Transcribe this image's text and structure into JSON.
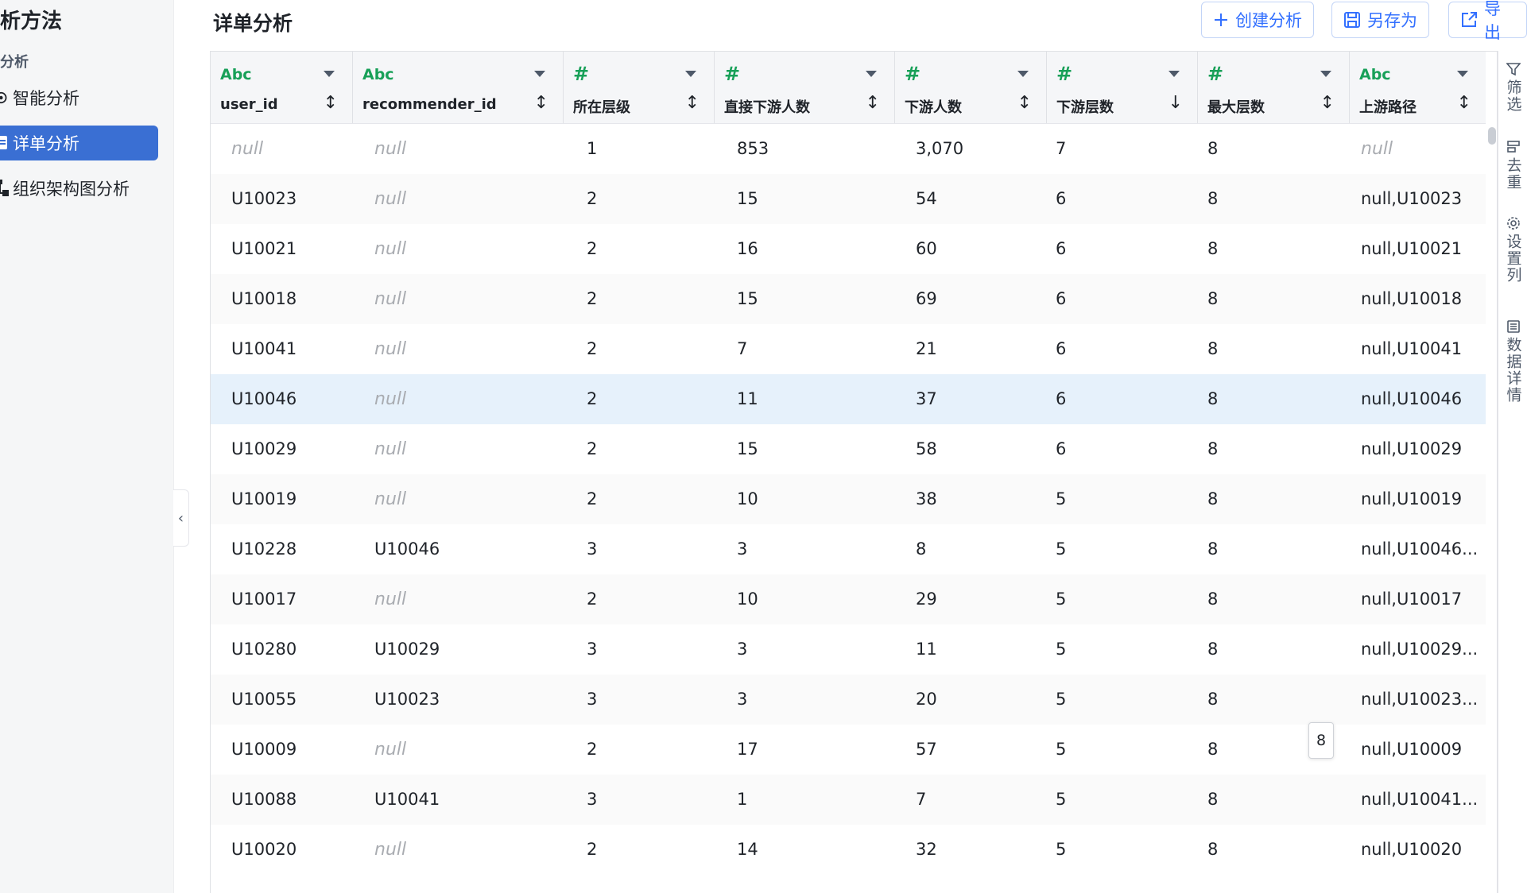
{
  "sidebar": {
    "title": "析方法",
    "section": "分析",
    "items": [
      {
        "label": "智能分析",
        "icon": "dashboard-icon",
        "active": false
      },
      {
        "label": "详单分析",
        "icon": "document-icon",
        "active": true
      },
      {
        "label": "组织架构图分析",
        "icon": "org-chart-icon",
        "active": false
      }
    ],
    "collapse_icon": "chevron-left-icon"
  },
  "header": {
    "title": "详单分析",
    "buttons": {
      "create": "创建分析",
      "save_as": "另存为",
      "export": "导出"
    }
  },
  "table": {
    "columns": [
      {
        "type": "Abc",
        "name": "user_id",
        "sort": "↕"
      },
      {
        "type": "Abc",
        "name": "recommender_id",
        "sort": "↕"
      },
      {
        "type": "#",
        "name": "所在层级",
        "sort": "↕"
      },
      {
        "type": "#",
        "name": "直接下游人数",
        "sort": "↕"
      },
      {
        "type": "#",
        "name": "下游人数",
        "sort": "↕"
      },
      {
        "type": "#",
        "name": "下游层数",
        "sort": "↓"
      },
      {
        "type": "#",
        "name": "最大层数",
        "sort": "↕"
      },
      {
        "type": "Abc",
        "name": "上游路径",
        "sort": "↕"
      }
    ],
    "rows": [
      [
        "null",
        "null",
        "1",
        "853",
        "3,070",
        "7",
        "8",
        "null"
      ],
      [
        "U10023",
        "null",
        "2",
        "15",
        "54",
        "6",
        "8",
        "null,U10023"
      ],
      [
        "U10021",
        "null",
        "2",
        "16",
        "60",
        "6",
        "8",
        "null,U10021"
      ],
      [
        "U10018",
        "null",
        "2",
        "15",
        "69",
        "6",
        "8",
        "null,U10018"
      ],
      [
        "U10041",
        "null",
        "2",
        "7",
        "21",
        "6",
        "8",
        "null,U10041"
      ],
      [
        "U10046",
        "null",
        "2",
        "11",
        "37",
        "6",
        "8",
        "null,U10046"
      ],
      [
        "U10029",
        "null",
        "2",
        "15",
        "58",
        "6",
        "8",
        "null,U10029"
      ],
      [
        "U10019",
        "null",
        "2",
        "10",
        "38",
        "5",
        "8",
        "null,U10019"
      ],
      [
        "U10228",
        "U10046",
        "3",
        "3",
        "8",
        "5",
        "8",
        "null,U10046..."
      ],
      [
        "U10017",
        "null",
        "2",
        "10",
        "29",
        "5",
        "8",
        "null,U10017"
      ],
      [
        "U10280",
        "U10029",
        "3",
        "3",
        "11",
        "5",
        "8",
        "null,U10029..."
      ],
      [
        "U10055",
        "U10023",
        "3",
        "3",
        "20",
        "5",
        "8",
        "null,U10023..."
      ],
      [
        "U10009",
        "null",
        "2",
        "17",
        "57",
        "5",
        "8",
        "null,U10009"
      ],
      [
        "U10088",
        "U10041",
        "3",
        "1",
        "7",
        "5",
        "8",
        "null,U10041..."
      ],
      [
        "U10020",
        "null",
        "2",
        "14",
        "32",
        "5",
        "8",
        "null,U10020"
      ]
    ],
    "highlighted_row": 5,
    "tooltip": "8"
  },
  "rail": {
    "items": [
      {
        "label": "筛选",
        "icon": "filter-icon"
      },
      {
        "label": "去重",
        "icon": "dedupe-icon"
      },
      {
        "label": "设置列",
        "icon": "gear-icon"
      },
      {
        "label": "数据详情",
        "icon": "list-icon"
      }
    ]
  },
  "colors": {
    "accent": "#3370ff",
    "active_item": "#3a6fd3",
    "type_tag": "#18a058",
    "null_text": "#a9acb1",
    "row_highlight": "#e6f1fb"
  }
}
